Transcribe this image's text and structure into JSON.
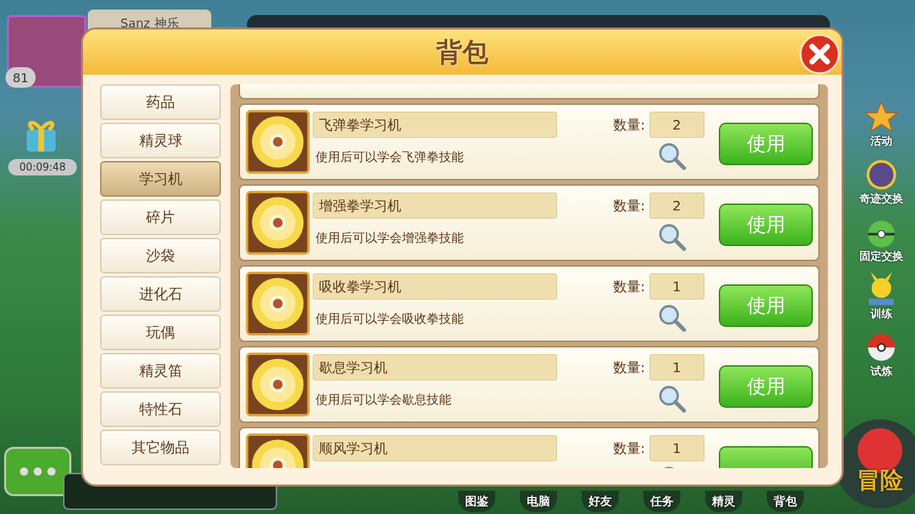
{
  "player": {
    "name": "Sanz 神乐",
    "level": "81"
  },
  "gift": {
    "timer": "00:09:48"
  },
  "side_menu": [
    {
      "label": "活动",
      "kind": "star"
    },
    {
      "label": "奇迹交换",
      "kind": "orb"
    },
    {
      "label": "固定交换",
      "kind": "ball2"
    },
    {
      "label": "训练",
      "kind": "mouse"
    },
    {
      "label": "试炼",
      "kind": "ball"
    }
  ],
  "bottom_menu": [
    {
      "label": "图鉴"
    },
    {
      "label": "电脑"
    },
    {
      "label": "好友"
    },
    {
      "label": "任务"
    },
    {
      "label": "精灵"
    },
    {
      "label": "背包"
    }
  ],
  "adventure_button": "冒险",
  "dialog": {
    "title": "背包",
    "categories": [
      {
        "label": "药品",
        "selected": false
      },
      {
        "label": "精灵球",
        "selected": false
      },
      {
        "label": "学习机",
        "selected": true
      },
      {
        "label": "碎片",
        "selected": false
      },
      {
        "label": "沙袋",
        "selected": false
      },
      {
        "label": "进化石",
        "selected": false
      },
      {
        "label": "玩偶",
        "selected": false
      },
      {
        "label": "精灵笛",
        "selected": false
      },
      {
        "label": "特性石",
        "selected": false
      },
      {
        "label": "其它物品",
        "selected": false
      }
    ],
    "items": [
      {
        "name": "飞弹拳学习机",
        "count_label": "数量:",
        "count": "2",
        "description": "使用后可以学会飞弹拳技能",
        "button": "使用"
      },
      {
        "name": "增强拳学习机",
        "count_label": "数量:",
        "count": "2",
        "description": "使用后可以学会增强拳技能",
        "button": "使用"
      },
      {
        "name": "吸收拳学习机",
        "count_label": "数量:",
        "count": "1",
        "description": "使用后可以学会吸收拳技能",
        "button": "使用"
      },
      {
        "name": "歇息学习机",
        "count_label": "数量:",
        "count": "1",
        "description": "使用后可以学会歇息技能",
        "button": "使用"
      },
      {
        "name": "顺风学习机",
        "count_label": "数量:",
        "count": "1"
      }
    ]
  }
}
